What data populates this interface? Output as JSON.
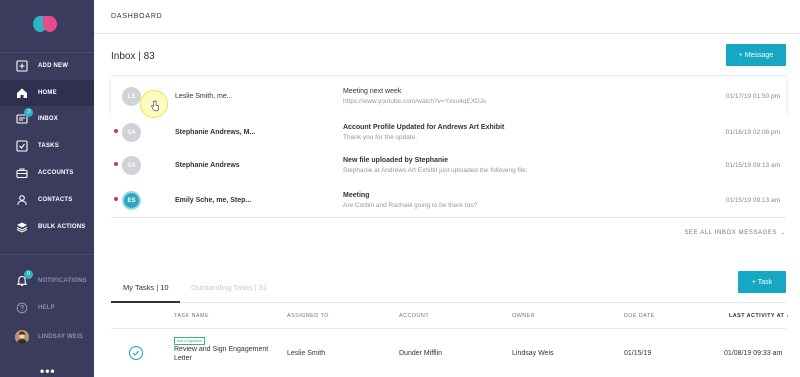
{
  "sidebar": {
    "items": [
      {
        "label": "ADD NEW",
        "icon": "plus-square-icon"
      },
      {
        "label": "HOME",
        "icon": "home-icon"
      },
      {
        "label": "INBOX",
        "icon": "inbox-icon",
        "badge": "3"
      },
      {
        "label": "TASKS",
        "icon": "checkbox-icon"
      },
      {
        "label": "ACCOUNTS",
        "icon": "briefcase-icon"
      },
      {
        "label": "CONTACTS",
        "icon": "person-icon"
      },
      {
        "label": "BULK ACTIONS",
        "icon": "layers-icon"
      }
    ],
    "bottom": [
      {
        "label": "NOTIFICATIONS",
        "icon": "bell-icon",
        "badge": "0"
      },
      {
        "label": "HELP",
        "icon": "help-icon"
      },
      {
        "label": "LINDSAY WEIS",
        "icon": "user-avatar"
      }
    ],
    "more": "•••"
  },
  "topbar": {
    "title": "DASHBOARD"
  },
  "inbox": {
    "title": "Inbox | 83",
    "message_button": "+   Message",
    "see_all": "SEE ALL INBOX MESSAGES →",
    "messages": [
      {
        "initials": "LS",
        "sender": "Leslie Smith, me...",
        "subject": "Meeting next week",
        "preview": "https://www.youtube.com/watch?v=Yxxu4qEXDJs",
        "date": "01/17/19 01:50 pm",
        "unread": false
      },
      {
        "initials": "SA",
        "sender": "Stephanie Andrews, M...",
        "subject": "Account Profile Updated for Andrews Art Exhibit",
        "preview": "Thank you for the update.",
        "date": "01/16/19 02:08 pm",
        "unread": true
      },
      {
        "initials": "SA",
        "sender": "Stephanie Andrews",
        "subject": "New file uploaded by Stephanie",
        "preview": "Stephanie at Andrews Art Exhibit just uploaded the following file:",
        "date": "01/15/19 09:13 am",
        "unread": true
      },
      {
        "initials": "ES",
        "sender": "Emily Sche, me, Step...",
        "subject": "Meeting",
        "preview": "Are Corbin and Rachael going to be there too?",
        "date": "01/15/19 09:13 am",
        "unread": true
      }
    ]
  },
  "tasks": {
    "tabs": [
      "My Tasks | 10",
      "Outstanding Tasks | 31"
    ],
    "task_button": "+   Task",
    "columns": [
      "TASK NAME",
      "ASSIGNED TO",
      "ACCOUNT",
      "OWNER",
      "DUE DATE",
      "LAST ACTIVITY AT ↓"
    ],
    "rows": [
      {
        "tag": "Add a Signature",
        "name_line1": "Review and Sign Engagement",
        "name_line2": "Letter",
        "assigned_to": "Leslie Smith",
        "account": "Dunder Mifflin",
        "owner": "Lindsay Weis",
        "due": "01/15/19",
        "last_activity": "01/08/19 09:33 am"
      }
    ]
  },
  "colors": {
    "sidebar": "#3b3c5d",
    "accent": "#16a7c2",
    "unread": "#c2376e"
  }
}
